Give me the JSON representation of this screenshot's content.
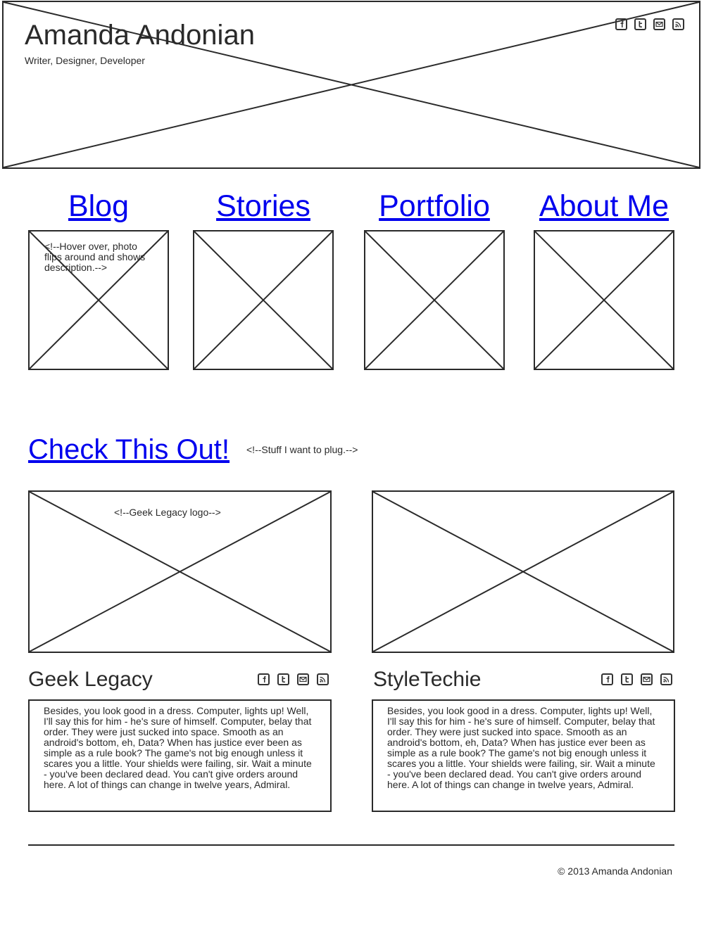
{
  "header": {
    "name": "Amanda Andonian",
    "tagline": "Writer, Designer, Developer",
    "social_icons": [
      "facebook-icon",
      "twitter-icon",
      "email-icon",
      "rss-icon"
    ]
  },
  "nav": {
    "items": [
      {
        "label": "Blog"
      },
      {
        "label": "Stories"
      },
      {
        "label": "Portfolio"
      },
      {
        "label": "About Me"
      }
    ],
    "hover_note": "<!--Hover over, photo flips around and shows description.-->"
  },
  "plug": {
    "title": "Check This Out!",
    "note": "<!--Stuff I want to plug.-->"
  },
  "cards": [
    {
      "title": "Geek Legacy",
      "image_note": "<!--Geek Legacy logo-->",
      "body": "Besides, you look good in a dress. Computer, lights up! Well, I'll say this for him - he's sure of himself. Computer, belay that order. They were just sucked into space. Smooth as an android's bottom, eh, Data? When has justice ever been as simple as a rule book? The game's not big enough unless it scares you a little. Your shields were failing, sir. Wait a minute - you've been declared dead. You can't give orders around here. A lot of things can change in twelve years, Admiral."
    },
    {
      "title": "StyleTechie",
      "body": "Besides, you look good in a dress. Computer, lights up! Well, I'll say this for him - he's sure of himself. Computer, belay that order. They were just sucked into space. Smooth as an android's bottom, eh, Data? When has justice ever been as simple as a rule book? The game's not big enough unless it scares you a little. Your shields were failing, sir. Wait a minute - you've been declared dead. You can't give orders around here. A lot of things can change in twelve years, Admiral."
    }
  ],
  "footer": {
    "copyright": "© 2013 Amanda Andonian"
  }
}
